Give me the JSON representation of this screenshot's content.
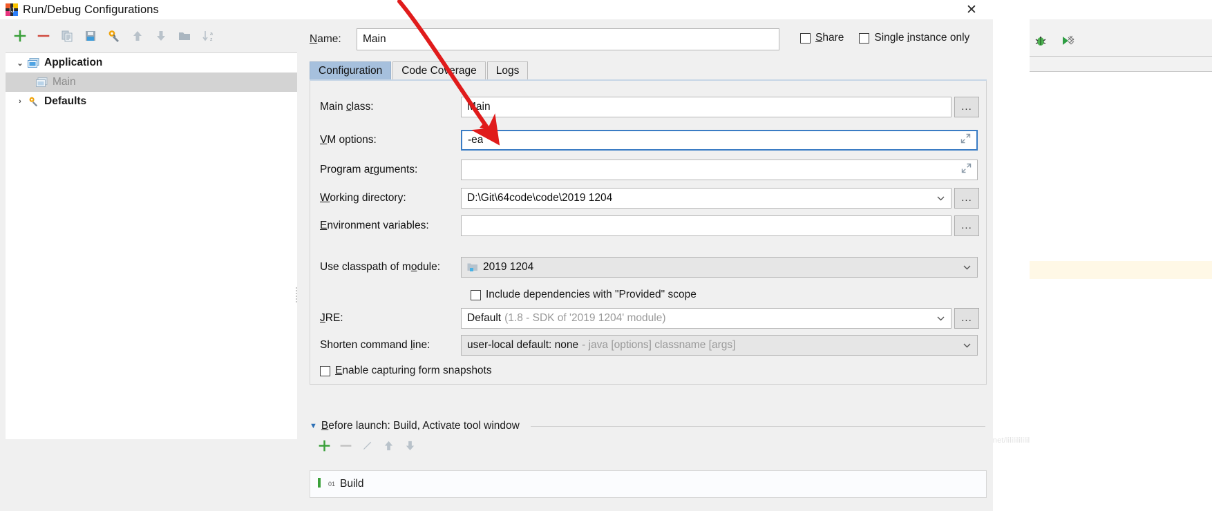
{
  "window": {
    "title": "Run/Debug Configurations",
    "app_icon": "intellij-idea-icon",
    "close_label": "✕"
  },
  "ide_background": {
    "minimize_label": "—",
    "debug_icon": "debug-bug-icon",
    "run_coverage_icon": "run-with-coverage-icon",
    "watermark": "https://blog.csdn.net/lilililililil"
  },
  "left_panel": {
    "toolbar": [
      {
        "name": "add-configuration-button",
        "icon": "plus-icon",
        "label": "+"
      },
      {
        "name": "remove-configuration-button",
        "icon": "minus-icon",
        "label": "−"
      },
      {
        "name": "copy-configuration-button",
        "icon": "copy-icon",
        "label": ""
      },
      {
        "name": "save-configuration-button",
        "icon": "save-floppy-icon",
        "label": ""
      },
      {
        "name": "edit-defaults-button",
        "icon": "wrench-gear-icon",
        "label": ""
      },
      {
        "name": "move-up-button",
        "icon": "arrow-up-icon",
        "label": ""
      },
      {
        "name": "move-down-button",
        "icon": "arrow-down-icon",
        "label": ""
      },
      {
        "name": "create-folder-button",
        "icon": "folder-icon",
        "label": ""
      },
      {
        "name": "sort-configurations-button",
        "icon": "sort-az-icon",
        "label": ""
      }
    ],
    "tree": [
      {
        "label": "Application",
        "icon": "application-icon",
        "expanded": true,
        "level": 0,
        "selected": false,
        "dim": false,
        "bold": true,
        "twisty": "⌄"
      },
      {
        "label": "Main",
        "icon": "application-icon",
        "expanded": false,
        "level": 1,
        "selected": true,
        "dim": true,
        "bold": false,
        "twisty": ""
      },
      {
        "label": "Defaults",
        "icon": "wrench-gear-icon",
        "expanded": false,
        "level": 0,
        "selected": false,
        "dim": false,
        "bold": true,
        "twisty": "›"
      }
    ]
  },
  "right_panel": {
    "name_label": "Name:",
    "name_value": "Main",
    "share_checkbox": {
      "label": "Share",
      "checked": false
    },
    "single_instance_checkbox": {
      "label": "Single instance only",
      "checked": false
    },
    "tabs": [
      {
        "label": "Configuration",
        "active": true
      },
      {
        "label": "Code Coverage",
        "active": false
      },
      {
        "label": "Logs",
        "active": false
      }
    ],
    "fields": {
      "main_class": {
        "label": "Main class:",
        "value": "Main",
        "browse": "..."
      },
      "vm_options": {
        "label": "VM options:",
        "value": "-ea",
        "expand_icon": "expand-editor-icon"
      },
      "program_arguments": {
        "label": "Program arguments:",
        "value": "",
        "expand_icon": "expand-editor-icon"
      },
      "working_directory": {
        "label": "Working directory:",
        "value": "D:\\Git\\64code\\code\\2019 1204",
        "browse": "..."
      },
      "environment_variables": {
        "label": "Environment variables:",
        "value": "",
        "browse": "..."
      },
      "classpath_module": {
        "label": "Use classpath of module:",
        "value": "2019 1204",
        "icon": "module-folder-icon"
      },
      "include_provided": {
        "label": "Include dependencies with \"Provided\" scope",
        "checked": false
      },
      "jre": {
        "label": "JRE:",
        "value": "Default",
        "hint": "(1.8 - SDK of '2019 1204' module)",
        "browse": "..."
      },
      "shorten_command_line": {
        "label": "Shorten command line:",
        "value": "user-local default: none",
        "hint": "- java [options] classname [args]"
      },
      "form_snapshots": {
        "label": "Enable capturing form snapshots",
        "checked": false
      }
    },
    "before_launch": {
      "title": "Before launch: Build, Activate tool window",
      "toolbar": [
        {
          "name": "add-task-button",
          "icon": "plus-icon"
        },
        {
          "name": "remove-task-button",
          "icon": "minus-icon"
        },
        {
          "name": "edit-task-button",
          "icon": "pencil-icon"
        },
        {
          "name": "move-task-up-button",
          "icon": "arrow-up-icon"
        },
        {
          "name": "move-task-down-button",
          "icon": "arrow-down-icon"
        }
      ],
      "items": [
        {
          "badge": "01",
          "label": "Build"
        }
      ]
    }
  },
  "colors": {
    "accent_blue": "#3a7cc4",
    "tab_active": "#a6c0dd",
    "dialog_bg": "#f0f0f0",
    "annotation_red": "#e01b1b",
    "green_icon": "#4caf50",
    "red_icon": "#d9534f"
  }
}
